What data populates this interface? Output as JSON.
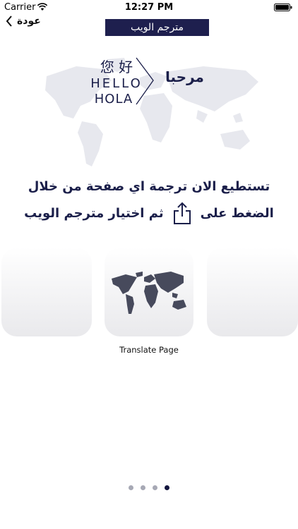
{
  "status_bar": {
    "carrier": "Carrier",
    "time": "12:27 PM"
  },
  "nav": {
    "back_label": "عودة",
    "title": "مترجم الويب"
  },
  "hero": {
    "logo_chinese": "您 好",
    "logo_hello": "HELLO",
    "logo_hola": "HOLA",
    "welcome": "مرحبا"
  },
  "instructions": {
    "line1": "تستطيع الان ترجمة اي صفحة من خلال",
    "line2_before": "الضغط على",
    "line2_after": "ثم اختيار مترجم الويب",
    "share_icon": "share-icon"
  },
  "carousel": {
    "center_caption": "Translate Page",
    "icon": "world-map-icon"
  },
  "pagination": {
    "count": 4,
    "active_index": 3
  },
  "colors": {
    "navy": "#1e1f4e",
    "dot_inactive": "#a7a9b5",
    "dot_active": "#14163e"
  }
}
